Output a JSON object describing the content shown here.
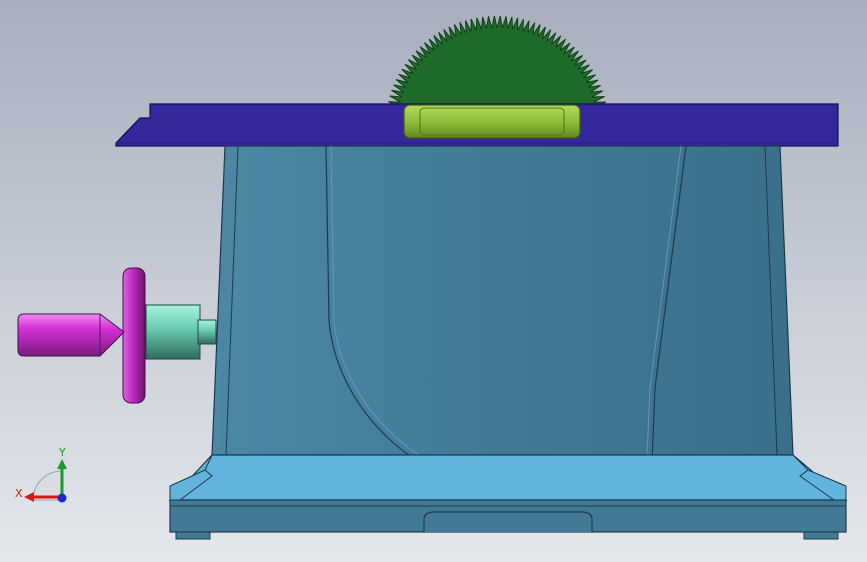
{
  "viewport": {
    "background_top": "#a7aebd",
    "background_bottom": "#e5e8ec"
  },
  "model": {
    "parts": [
      {
        "name": "saw-blade",
        "color": "#1e6b2a"
      },
      {
        "name": "table-top",
        "color": "#33279b"
      },
      {
        "name": "insert-plate",
        "color": "#8fbf3a"
      },
      {
        "name": "housing",
        "color": "#427a96"
      },
      {
        "name": "base",
        "color": "#62b4dd"
      },
      {
        "name": "handwheel-knob",
        "color": "#d531d5"
      },
      {
        "name": "handwheel-disc",
        "color": "#b62ab8"
      },
      {
        "name": "shaft",
        "color": "#6fd0b6"
      }
    ]
  },
  "triad": {
    "x_label": "X",
    "y_label": "Y",
    "x_color": "#d11a1a",
    "y_color": "#1a9a2a",
    "z_color": "#1a2ad1"
  }
}
